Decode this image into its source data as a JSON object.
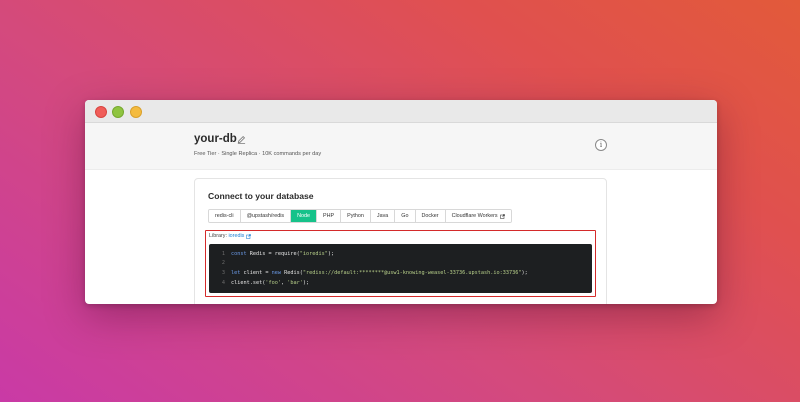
{
  "header": {
    "db_name": "your-db",
    "meta": "Free Tier · Single Replica · 10K commands per day",
    "info_glyph": "i"
  },
  "connect": {
    "title": "Connect to your database",
    "tabs": [
      {
        "label": "redis-cli",
        "active": false
      },
      {
        "label": "@upstash/redis",
        "active": false
      },
      {
        "label": "Node",
        "active": true
      },
      {
        "label": "PHP",
        "active": false
      },
      {
        "label": "Python",
        "active": false
      },
      {
        "label": "Java",
        "active": false
      },
      {
        "label": "Go",
        "active": false
      },
      {
        "label": "Docker",
        "active": false
      },
      {
        "label": "Cloudflare Workers",
        "active": false,
        "external": true
      }
    ],
    "library_label": "Library:",
    "library_link": "ioredis",
    "code": {
      "line1_kw": "const",
      "line1_rest": " Redis = require(",
      "line1_str": "\"ioredis\"",
      "line1_end": ");",
      "line3_kw": "let",
      "line3_mid": " client = ",
      "line3_kw2": "new",
      "line3_rest": " Redis(",
      "line3_str": "\"rediss://default:********@usw1-knowing-weasel-33736.upstash.io:33736\"",
      "line3_end": ");",
      "line4_rest": "client.set(",
      "line4_str1": "'foo'",
      "line4_mid": ", ",
      "line4_str2": "'bar'",
      "line4_end": ");"
    }
  },
  "colors": {
    "accent": "#16c28a",
    "highlight": "#d42a2a",
    "link": "#1a7fd4",
    "code_bg": "#1d1f21"
  },
  "icons": [
    "edit-icon",
    "info-icon",
    "external-link-icon"
  ]
}
